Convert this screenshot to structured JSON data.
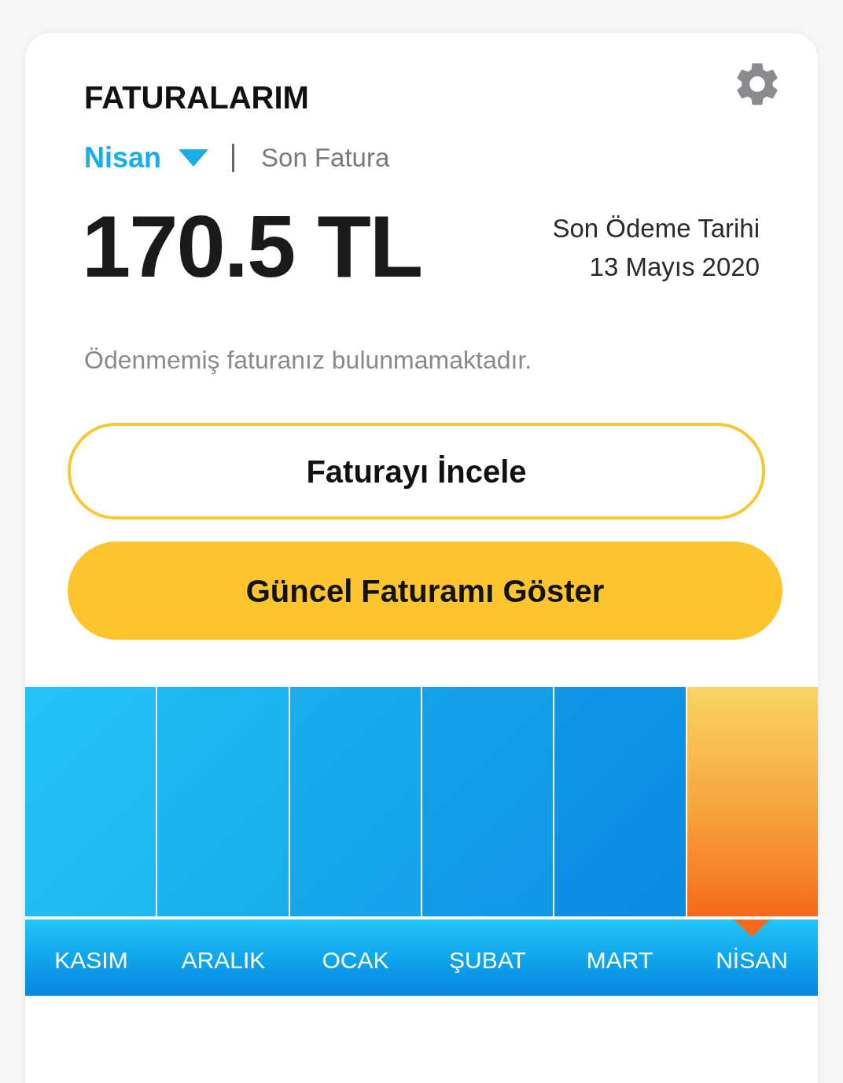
{
  "title": "FATURALARIM",
  "period": {
    "month": "Nisan",
    "label": "Son Fatura"
  },
  "amount": "170.5 TL",
  "due": {
    "label": "Son Ödeme Tarihi",
    "date": "13 Mayıs 2020"
  },
  "message": "Ödenmemiş faturanız bulunmamaktadır.",
  "buttons": [
    {
      "label": "Faturayı İncele",
      "kind": "outline"
    },
    {
      "label": "Güncel Faturamı Göster",
      "kind": "filled"
    }
  ],
  "months": [
    {
      "label": "KASIM",
      "selected": false
    },
    {
      "label": "ARALIK",
      "selected": false
    },
    {
      "label": "OCAK",
      "selected": false
    },
    {
      "label": "ŞUBAT",
      "selected": false
    },
    {
      "label": "MART",
      "selected": false
    },
    {
      "label": "NİSAN",
      "selected": true
    }
  ]
}
